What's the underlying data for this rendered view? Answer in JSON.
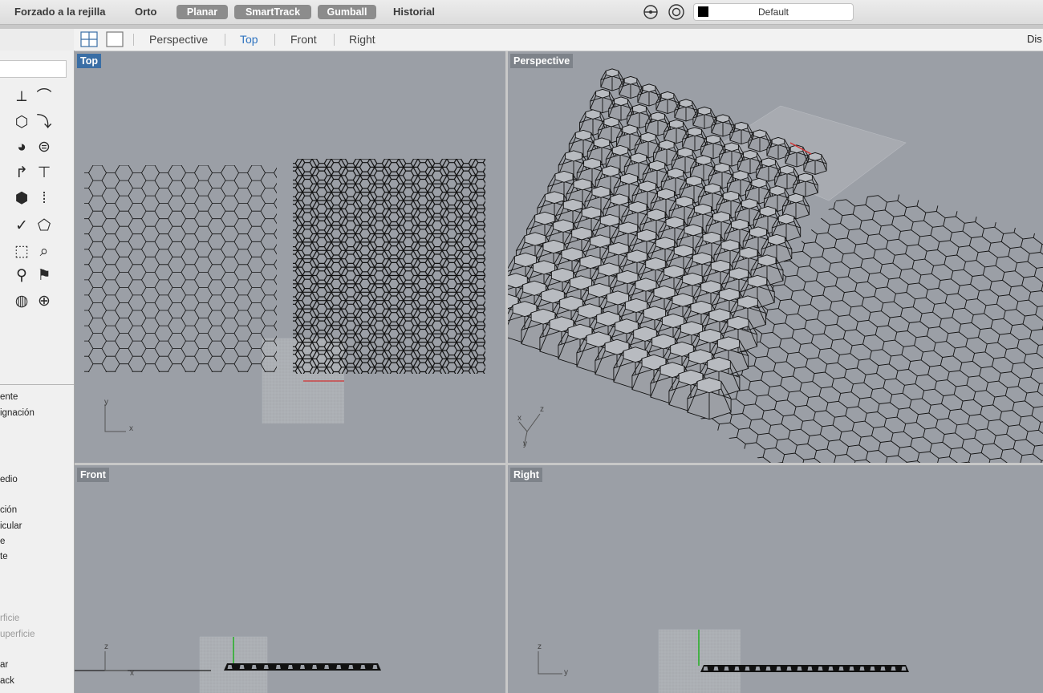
{
  "statusbar": {
    "grid_snap": "Forzado a la rejilla",
    "ortho": "Orto",
    "planar": "Planar",
    "smarttrack": "SmartTrack",
    "gumball": "Gumball",
    "history": "Historial",
    "layer": "Default",
    "layer_color": "#000000"
  },
  "viewport_tabs": {
    "perspective": "Perspective",
    "top": "Top",
    "front": "Front",
    "right": "Right",
    "overflow": "Dis",
    "active": "Top"
  },
  "toolbox": {
    "commands": [
      "ente",
      "ignación",
      "edio",
      "ción",
      "icular",
      "e",
      "te",
      "rficie",
      "uperficie",
      "ar",
      "ack"
    ],
    "dim_commands": [
      "rficie",
      "uperficie"
    ]
  },
  "viewports": {
    "top": {
      "label": "Top",
      "axis_x": "x",
      "axis_y": "y"
    },
    "perspective": {
      "label": "Perspective",
      "axis_x": "x",
      "axis_y": "y",
      "axis_z": "z"
    },
    "front": {
      "label": "Front",
      "axis_x": "x",
      "axis_z": "z"
    },
    "right": {
      "label": "Right",
      "axis_y": "y",
      "axis_z": "z"
    }
  },
  "colors": {
    "viewport_bg": "#9b9fa6",
    "active_label": "#3a6ea5",
    "active_tab": "#2f74c0",
    "x_axis": "#d03030",
    "z_axis": "#22b022"
  }
}
